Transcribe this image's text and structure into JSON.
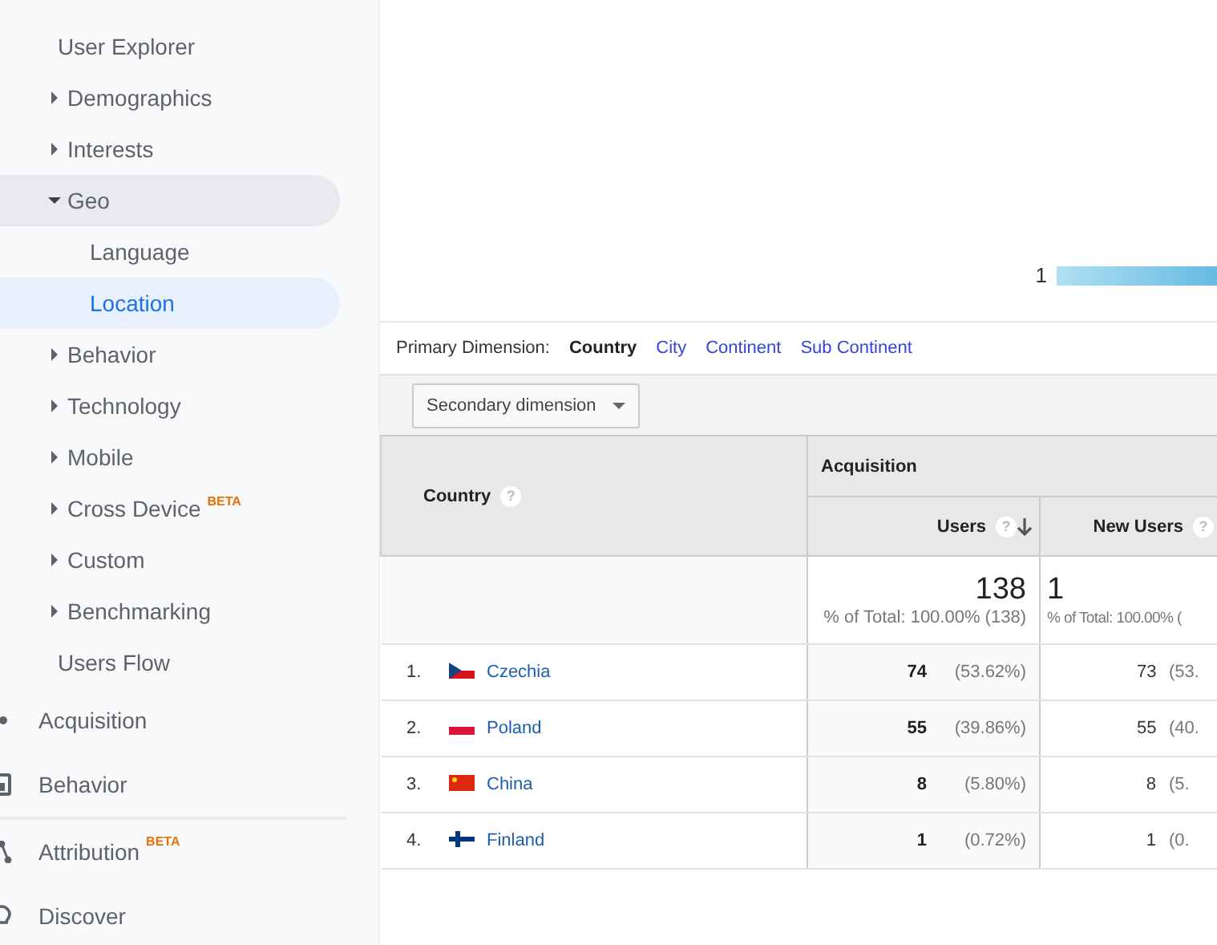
{
  "sidebar": {
    "items": [
      {
        "kind": "link",
        "label": "User Explorer",
        "selected": false
      },
      {
        "kind": "group",
        "label": "Demographics",
        "expanded": false,
        "selected": false
      },
      {
        "kind": "group",
        "label": "Interests",
        "expanded": false,
        "selected": false
      },
      {
        "kind": "group",
        "label": "Geo",
        "expanded": true,
        "selected": true,
        "children": [
          {
            "kind": "link",
            "label": "Language",
            "selected": false
          },
          {
            "kind": "link",
            "label": "Location",
            "selected": true
          }
        ]
      },
      {
        "kind": "group",
        "label": "Behavior",
        "expanded": false,
        "selected": false
      },
      {
        "kind": "group",
        "label": "Technology",
        "expanded": false,
        "selected": false
      },
      {
        "kind": "group",
        "label": "Mobile",
        "expanded": false,
        "selected": false
      },
      {
        "kind": "group",
        "label": "Cross Device",
        "badge": "BETA",
        "expanded": false,
        "selected": false
      },
      {
        "kind": "group",
        "label": "Custom",
        "expanded": false,
        "selected": false
      },
      {
        "kind": "group",
        "label": "Benchmarking",
        "expanded": false,
        "selected": false
      },
      {
        "kind": "link",
        "label": "Users Flow",
        "selected": false
      }
    ],
    "sections": [
      {
        "label": "Acquisition"
      },
      {
        "label": "Behavior"
      },
      {
        "label": "Attribution",
        "badge": "BETA"
      },
      {
        "label": "Discover"
      }
    ]
  },
  "map": {
    "legend_min": "1"
  },
  "primary_dimension": {
    "label": "Primary Dimension:",
    "options": [
      {
        "label": "Country",
        "selected": true
      },
      {
        "label": "City",
        "selected": false
      },
      {
        "label": "Continent",
        "selected": false
      },
      {
        "label": "Sub Continent",
        "selected": false
      }
    ]
  },
  "secondary_dimension": {
    "label": "Secondary dimension"
  },
  "table": {
    "group_header": "Acquisition",
    "columns": [
      {
        "label": "Country",
        "help": "?",
        "sorted": false
      },
      {
        "label": "Users",
        "help": "?",
        "sorted": true
      },
      {
        "label": "New Users",
        "help": "?",
        "sorted": false
      }
    ],
    "totals": [
      {
        "value": "138",
        "detail": "% of Total: 100.00% (138)"
      },
      {
        "value": "1",
        "detail": "% of Total: 100.00% ("
      }
    ],
    "rows": [
      {
        "rank": "1.",
        "country": "Czechia",
        "users": "74",
        "users_pct": "(53.62%)",
        "new_users": "73",
        "new_users_pct": "(53."
      },
      {
        "rank": "2.",
        "country": "Poland",
        "users": "55",
        "users_pct": "(39.86%)",
        "new_users": "55",
        "new_users_pct": "(40."
      },
      {
        "rank": "3.",
        "country": "China",
        "users": "8",
        "users_pct": "(5.80%)",
        "new_users": "8",
        "new_users_pct": "(5."
      },
      {
        "rank": "4.",
        "country": "Finland",
        "users": "1",
        "users_pct": "(0.72%)",
        "new_users": "1",
        "new_users_pct": "(0."
      }
    ]
  }
}
